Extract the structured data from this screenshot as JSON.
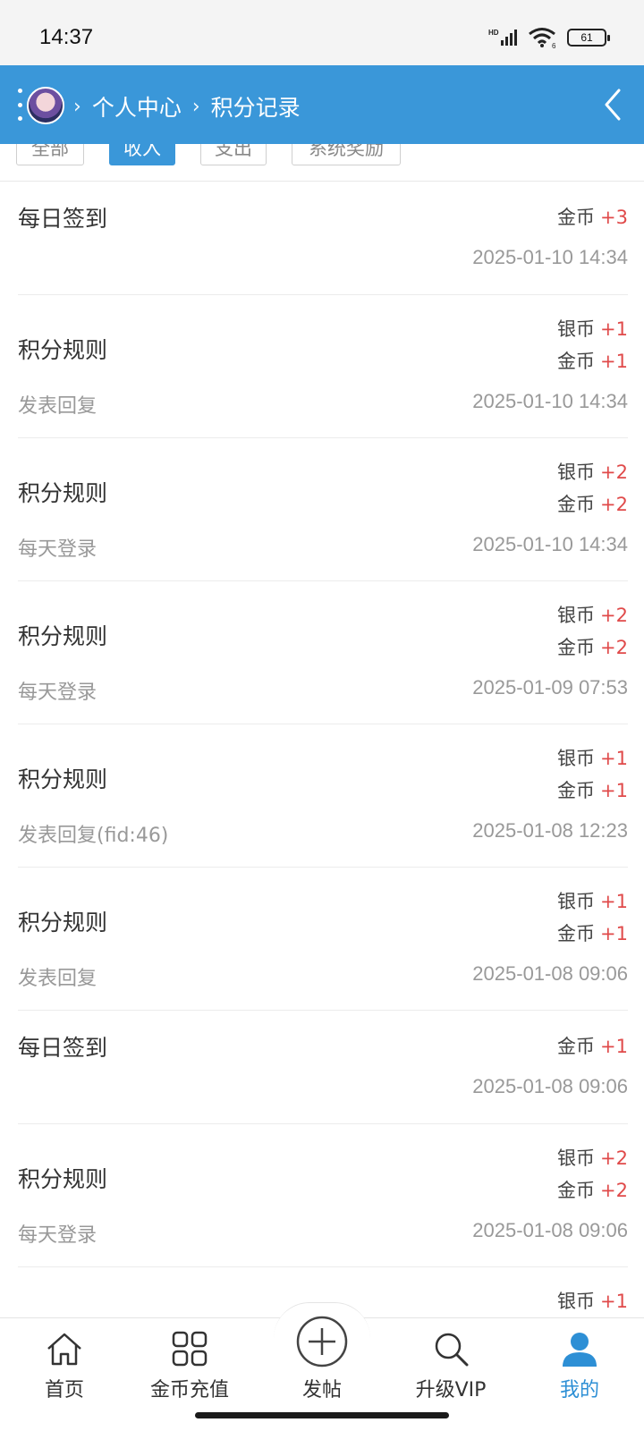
{
  "status_bar": {
    "time": "14:37",
    "battery": "61"
  },
  "header": {
    "breadcrumb": [
      "个人中心",
      "积分记录"
    ],
    "separator": "›"
  },
  "filters": [
    {
      "label": "全部",
      "active": false
    },
    {
      "label": "收入",
      "active": true
    },
    {
      "label": "支出",
      "active": false
    },
    {
      "label": "系统奖励",
      "active": false
    }
  ],
  "records": [
    {
      "title": "每日签到",
      "subtitle": "",
      "time": "2025-01-10 14:34",
      "amounts": [
        {
          "unit": "金币",
          "value": "+3"
        }
      ]
    },
    {
      "title": "积分规则",
      "subtitle": "发表回复",
      "time": "2025-01-10 14:34",
      "amounts": [
        {
          "unit": "银币",
          "value": "+1"
        },
        {
          "unit": "金币",
          "value": "+1"
        }
      ]
    },
    {
      "title": "积分规则",
      "subtitle": "每天登录",
      "time": "2025-01-10 14:34",
      "amounts": [
        {
          "unit": "银币",
          "value": "+2"
        },
        {
          "unit": "金币",
          "value": "+2"
        }
      ]
    },
    {
      "title": "积分规则",
      "subtitle": "每天登录",
      "time": "2025-01-09 07:53",
      "amounts": [
        {
          "unit": "银币",
          "value": "+2"
        },
        {
          "unit": "金币",
          "value": "+2"
        }
      ]
    },
    {
      "title": "积分规则",
      "subtitle": "发表回复(fid:46)",
      "time": "2025-01-08 12:23",
      "amounts": [
        {
          "unit": "银币",
          "value": "+1"
        },
        {
          "unit": "金币",
          "value": "+1"
        }
      ]
    },
    {
      "title": "积分规则",
      "subtitle": "发表回复",
      "time": "2025-01-08 09:06",
      "amounts": [
        {
          "unit": "银币",
          "value": "+1"
        },
        {
          "unit": "金币",
          "value": "+1"
        }
      ]
    },
    {
      "title": "每日签到",
      "subtitle": "",
      "time": "2025-01-08 09:06",
      "amounts": [
        {
          "unit": "金币",
          "value": "+1"
        }
      ]
    },
    {
      "title": "积分规则",
      "subtitle": "每天登录",
      "time": "2025-01-08 09:06",
      "amounts": [
        {
          "unit": "银币",
          "value": "+2"
        },
        {
          "unit": "金币",
          "value": "+2"
        }
      ]
    },
    {
      "title": "",
      "subtitle": "",
      "time": "",
      "amounts": [
        {
          "unit": "银币",
          "value": "+1"
        }
      ]
    }
  ],
  "bottom_nav": [
    {
      "label": "首页",
      "icon": "home-icon",
      "active": false
    },
    {
      "label": "金币充值",
      "icon": "grid-icon",
      "active": false
    },
    {
      "label": "发帖",
      "icon": "plus-circle-icon",
      "active": false
    },
    {
      "label": "升级VIP",
      "icon": "search-icon",
      "active": false
    },
    {
      "label": "我的",
      "icon": "user-icon",
      "active": true
    }
  ],
  "colors": {
    "header": "#3a97d9",
    "accent_red": "#e04a4a",
    "active_blue": "#2d8fd5"
  }
}
